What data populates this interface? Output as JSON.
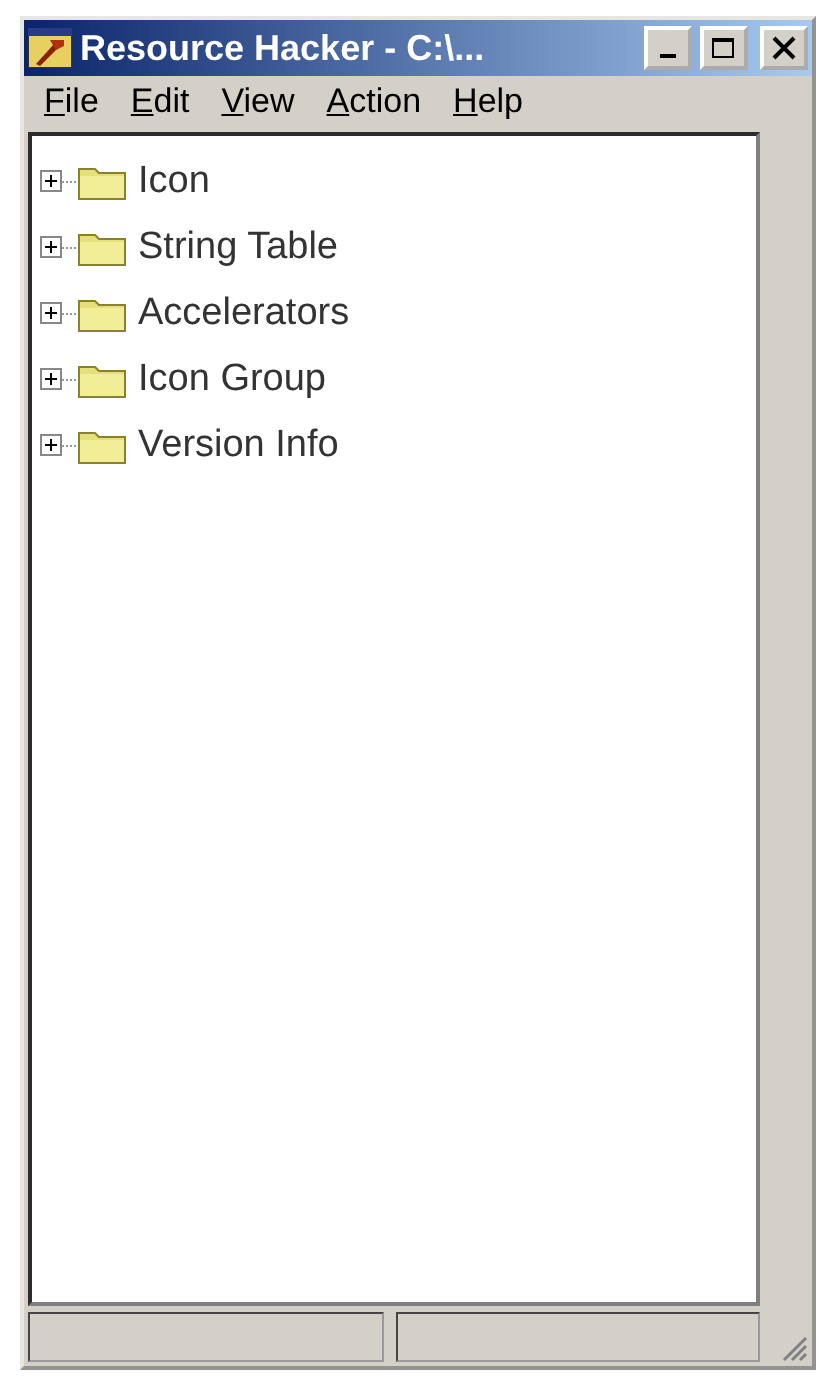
{
  "window": {
    "title": "Resource Hacker  -  C:\\..."
  },
  "menu": [
    {
      "label": "File"
    },
    {
      "label": "Edit"
    },
    {
      "label": "View"
    },
    {
      "label": "Action"
    },
    {
      "label": "Help"
    }
  ],
  "tree": [
    {
      "label": "Icon",
      "expanded": false
    },
    {
      "label": "String Table",
      "expanded": false
    },
    {
      "label": "Accelerators",
      "expanded": false
    },
    {
      "label": "Icon Group",
      "expanded": false
    },
    {
      "label": "Version Info",
      "expanded": false
    }
  ]
}
